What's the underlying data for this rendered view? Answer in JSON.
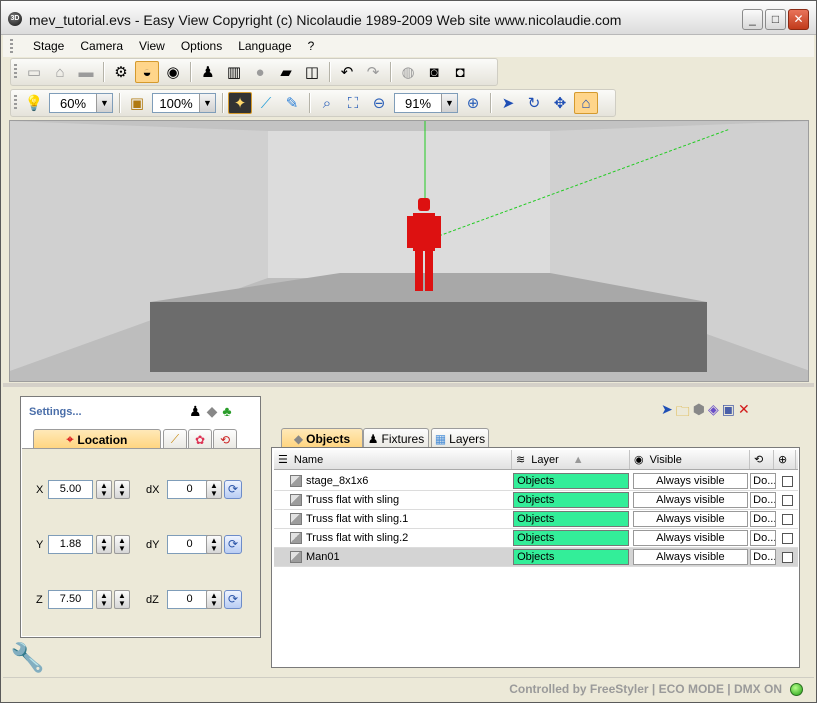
{
  "window": {
    "title": "mev_tutorial.evs - Easy View   Copyright (c) Nicolaudie 1989-2009    Web site www.nicolaudie.com",
    "app_icon_text": "3D",
    "minimize": "_",
    "maximize": "□",
    "close": "✕"
  },
  "menu": [
    "Stage",
    "Camera",
    "View",
    "Options",
    "Language",
    "?"
  ],
  "toolbar1": {
    "buttons": [
      {
        "name": "new-icon",
        "glyph": "▭",
        "state": "disabled"
      },
      {
        "name": "open-icon",
        "glyph": "⌂",
        "state": "disabled"
      },
      {
        "name": "save-icon",
        "glyph": "▬",
        "state": "disabled"
      },
      {
        "name": "wrench-icon",
        "glyph": "⚙",
        "state": "normal"
      },
      {
        "name": "spotlight-icon",
        "glyph": "◒",
        "state": "active"
      },
      {
        "name": "eye-icon",
        "glyph": "◉",
        "state": "normal"
      },
      {
        "name": "fixture-icon",
        "glyph": "♟",
        "state": "normal"
      },
      {
        "name": "dmx-icon",
        "glyph": "▥",
        "state": "normal"
      },
      {
        "name": "record-icon",
        "glyph": "●",
        "state": "disabled"
      },
      {
        "name": "console-icon",
        "glyph": "▰",
        "state": "normal"
      },
      {
        "name": "box3d-icon",
        "glyph": "◫",
        "state": "normal"
      },
      {
        "name": "undo-icon",
        "glyph": "↶",
        "state": "normal"
      },
      {
        "name": "redo-icon",
        "glyph": "↷",
        "state": "disabled"
      },
      {
        "name": "snapshot-icon",
        "glyph": "◍",
        "state": "disabled"
      },
      {
        "name": "camera-icon",
        "glyph": "◙",
        "state": "normal"
      },
      {
        "name": "video-icon",
        "glyph": "◘",
        "state": "normal"
      }
    ]
  },
  "toolbar2": {
    "light_level": "60%",
    "scale_level": "100%",
    "zoom_level": "91%",
    "dropdown_arrow": "▼"
  },
  "settings": {
    "title": "Settings...",
    "tab_location": "Location",
    "fields": [
      {
        "axis": "X",
        "value": "5.00",
        "delta_label": "dX",
        "delta": "0"
      },
      {
        "axis": "Y",
        "value": "1.88",
        "delta_label": "dY",
        "delta": "0"
      },
      {
        "axis": "Z",
        "value": "7.50",
        "delta_label": "dZ",
        "delta": "0"
      }
    ]
  },
  "objects_panel": {
    "tabs": [
      "Objects",
      "Fixtures",
      "Layers"
    ],
    "columns": {
      "name": "Name",
      "layer": "Layer",
      "visible": "Visible"
    },
    "rows": [
      {
        "name": "stage_8x1x6",
        "layer": "Objects",
        "visible": "Always visible",
        "extra": "Do..."
      },
      {
        "name": "Truss flat with sling",
        "layer": "Objects",
        "visible": "Always visible",
        "extra": "Do..."
      },
      {
        "name": "Truss flat with sling.1",
        "layer": "Objects",
        "visible": "Always visible",
        "extra": "Do..."
      },
      {
        "name": "Truss flat with sling.2",
        "layer": "Objects",
        "visible": "Always visible",
        "extra": "Do..."
      },
      {
        "name": "Man01",
        "layer": "Objects",
        "visible": "Always visible",
        "extra": "Do..."
      }
    ]
  },
  "status": {
    "text": "Controlled by FreeStyler  |  ECO MODE  |  DMX ON"
  },
  "colors": {
    "layer_green": "#33ee99",
    "figure_red": "#dd1111",
    "axis_green": "#22cc22",
    "stage_dark": "#6c6c6c"
  }
}
